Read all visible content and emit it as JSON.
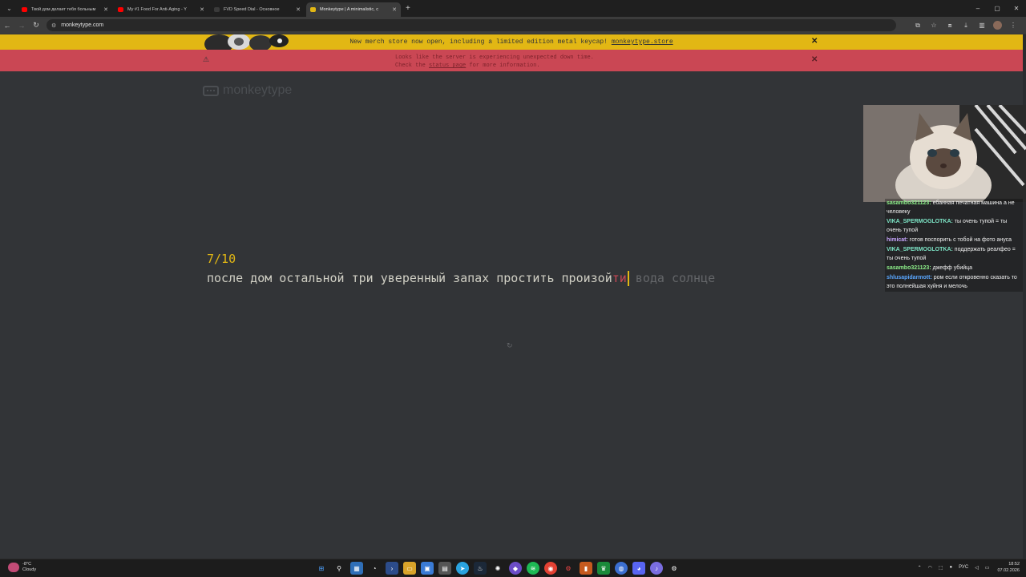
{
  "browser": {
    "tabs": [
      {
        "title": "Твой дом делает тебя больным",
        "favicon_color": "#ff0000",
        "active": false
      },
      {
        "title": "My #1 Food For Anti-Aging - Y",
        "favicon_color": "#ff0000",
        "active": false
      },
      {
        "title": "FVD Speed Dial - Основное",
        "favicon_color": "#3a3a3a",
        "active": false
      },
      {
        "title": "Monkeytype | A minimalistic, c",
        "favicon_color": "#e2b714",
        "active": true
      }
    ],
    "url": "monkeytype.com"
  },
  "banners": {
    "merch_text": "New merch store now open, including a limited edition metal keycap! ",
    "merch_link": "monkeytype.store",
    "alert_line1": "Looks like the server is experiencing unexpected down time.",
    "alert_line2_pre": "Check the ",
    "alert_link": "status page",
    "alert_line2_post": " for more information."
  },
  "app": {
    "logo_text": "monkeytype",
    "counter": "7/10",
    "typed_text": "после дом остальной три уверенный запах простить произой",
    "error_text": "ти",
    "untyped_text": "вода солнце",
    "colors": {
      "bg": "#323437",
      "main": "#e2b714",
      "text": "#d1d0c5",
      "sub": "#646669",
      "error": "#ca4754"
    }
  },
  "stream": {
    "chat": [
      {
        "user": "sasambo321123",
        "color": "#8ef08a",
        "text": "ебанная печатная машина а не человеку"
      },
      {
        "user": "VIKA_SPERMOGLOTKA",
        "color": "#7ee6c7",
        "text": "ты очень тупой = ты очень тупой"
      },
      {
        "user": "himicat",
        "color": "#c8a6ff",
        "text": "готов поспорить с тобой на фото ануса"
      },
      {
        "user": "VIKA_SPERMOGLOTKA",
        "color": "#7ee6c7",
        "text": "поддержать реалфео = ты очень тупой"
      },
      {
        "user": "sasambo321123",
        "color": "#8ef08a",
        "text": "джефф убийца"
      },
      {
        "user": "shlusapidarmott",
        "color": "#5aa7ff",
        "text": "ром если откровенно сказать то это полнейшая хуйня и мелочь"
      }
    ]
  },
  "taskbar": {
    "weather_temp": "-8°C",
    "weather_desc": "Cloudy",
    "lang": "РУС",
    "time": "18:52",
    "date": "07.02.2026"
  }
}
